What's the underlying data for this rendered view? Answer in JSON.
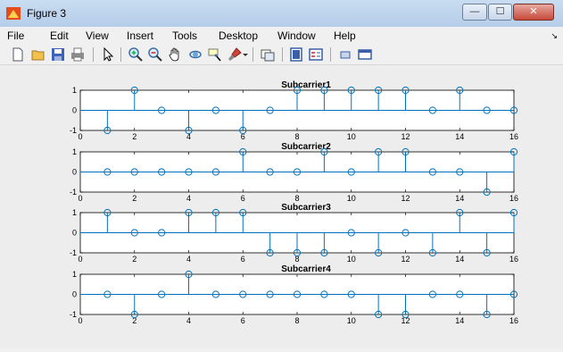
{
  "window": {
    "title": "Figure 3",
    "minimize_glyph": "—",
    "maximize_glyph": "☐",
    "close_glyph": "✕"
  },
  "menubar": {
    "items": [
      "File",
      "Edit",
      "View",
      "Insert",
      "Tools",
      "Desktop",
      "Window",
      "Help"
    ],
    "overflow_glyph": "↘"
  },
  "toolbar": {
    "icons": [
      "new-figure-icon",
      "open-file-icon",
      "save-icon",
      "print-icon",
      "edit-plot-arrow-icon",
      "zoom-in-icon",
      "zoom-out-icon",
      "pan-icon",
      "rotate-3d-icon",
      "data-cursor-icon",
      "brush-icon",
      "brush-dropdown-icon",
      "link-plot-icon",
      "colorbar-icon",
      "legend-icon",
      "hide-plot-tools-icon",
      "show-plot-tools-icon"
    ]
  },
  "colors": {
    "stem": "#0072bd",
    "axes": "#000000",
    "plot_bg": "#ffffff",
    "figure_bg": "#ededed"
  },
  "chart_data": [
    {
      "type": "stem",
      "title": "Subcarrier1",
      "x": [
        1,
        2,
        3,
        4,
        5,
        6,
        7,
        8,
        9,
        10,
        11,
        12,
        13,
        14,
        15,
        16
      ],
      "values": [
        -1,
        1,
        0,
        -1,
        0,
        -1,
        0,
        1,
        1,
        1,
        1,
        1,
        0,
        1,
        0,
        0
      ],
      "xlim": [
        0,
        16
      ],
      "ylim": [
        -1,
        1
      ],
      "xticks": [
        "0",
        "2",
        "4",
        "6",
        "8",
        "10",
        "12",
        "14",
        "16"
      ],
      "yticks": [
        "1",
        "0",
        "-1"
      ]
    },
    {
      "type": "stem",
      "title": "Subcarrier2",
      "x": [
        1,
        2,
        3,
        4,
        5,
        6,
        7,
        8,
        9,
        10,
        11,
        12,
        13,
        14,
        15,
        16
      ],
      "values": [
        0,
        0,
        0,
        0,
        0,
        1,
        0,
        0,
        1,
        0,
        1,
        1,
        0,
        0,
        -1,
        1
      ],
      "xlim": [
        0,
        16
      ],
      "ylim": [
        -1,
        1
      ],
      "xticks": [
        "0",
        "2",
        "4",
        "6",
        "8",
        "10",
        "12",
        "14",
        "16"
      ],
      "yticks": [
        "1",
        "0",
        "-1"
      ]
    },
    {
      "type": "stem",
      "title": "Subcarrier3",
      "x": [
        1,
        2,
        3,
        4,
        5,
        6,
        7,
        8,
        9,
        10,
        11,
        12,
        13,
        14,
        15,
        16
      ],
      "values": [
        1,
        0,
        0,
        1,
        1,
        1,
        -1,
        -1,
        -1,
        0,
        -1,
        0,
        -1,
        1,
        -1,
        1
      ],
      "xlim": [
        0,
        16
      ],
      "ylim": [
        -1,
        1
      ],
      "xticks": [
        "0",
        "2",
        "4",
        "6",
        "8",
        "10",
        "12",
        "14",
        "16"
      ],
      "yticks": [
        "1",
        "0",
        "-1"
      ]
    },
    {
      "type": "stem",
      "title": "Subcarrier4",
      "x": [
        1,
        2,
        3,
        4,
        5,
        6,
        7,
        8,
        9,
        10,
        11,
        12,
        13,
        14,
        15,
        16
      ],
      "values": [
        0,
        -1,
        0,
        1,
        0,
        0,
        0,
        0,
        0,
        0,
        -1,
        -1,
        0,
        0,
        -1,
        0
      ],
      "xlim": [
        0,
        16
      ],
      "ylim": [
        -1,
        1
      ],
      "xticks": [
        "0",
        "2",
        "4",
        "6",
        "8",
        "10",
        "12",
        "14",
        "16"
      ],
      "yticks": [
        "1",
        "0",
        "-1"
      ]
    }
  ]
}
